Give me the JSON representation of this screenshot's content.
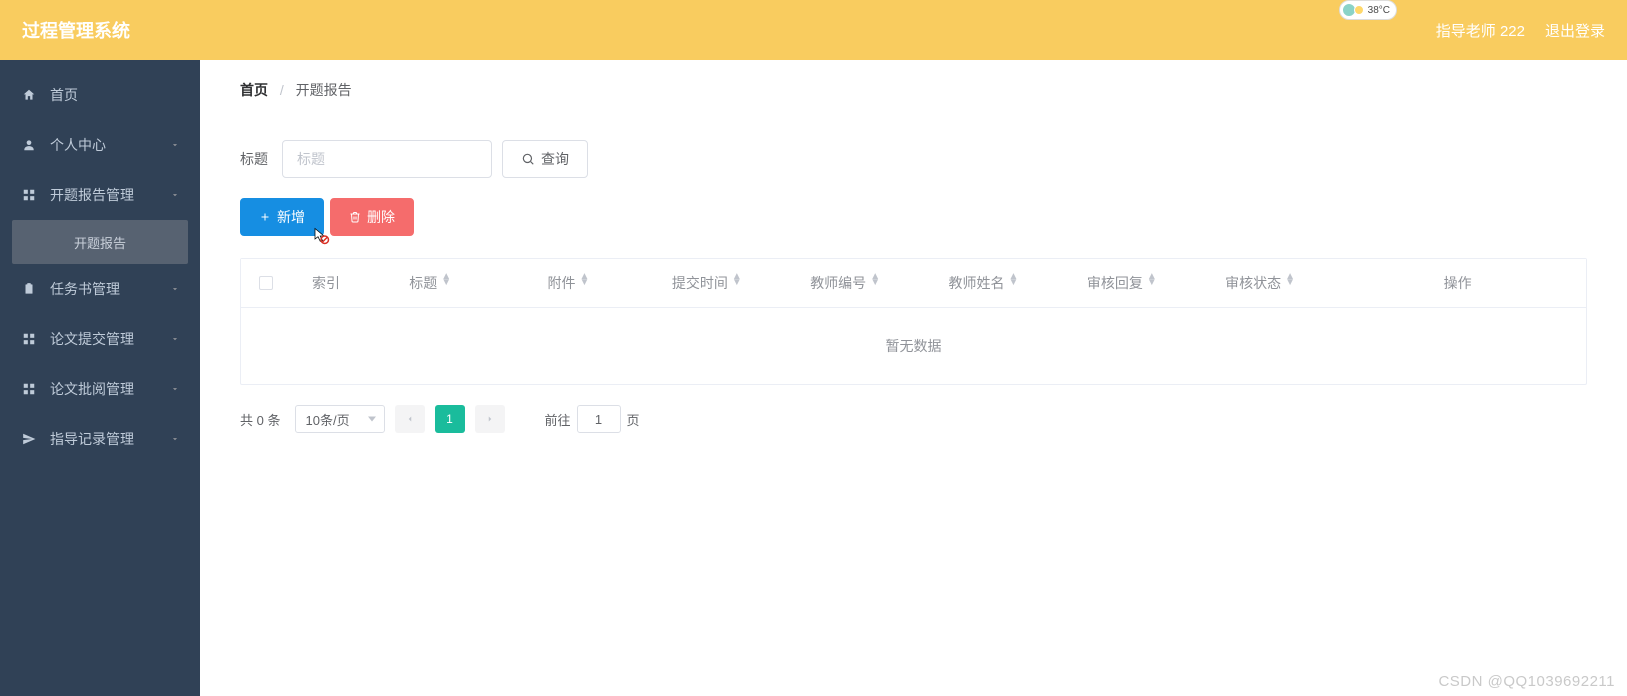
{
  "header": {
    "title": "过程管理系统",
    "user_label": "指导老师 222",
    "logout": "退出登录",
    "weather_temp": "38°C"
  },
  "sidebar": {
    "items": [
      {
        "icon": "home",
        "label": "首页",
        "has_arrow": false
      },
      {
        "icon": "person",
        "label": "个人中心",
        "has_arrow": true
      },
      {
        "icon": "grid",
        "label": "开题报告管理",
        "has_arrow": true,
        "open": true,
        "children": [
          {
            "label": "开题报告"
          }
        ]
      },
      {
        "icon": "clipboard",
        "label": "任务书管理",
        "has_arrow": true
      },
      {
        "icon": "grid",
        "label": "论文提交管理",
        "has_arrow": true
      },
      {
        "icon": "grid",
        "label": "论文批阅管理",
        "has_arrow": true
      },
      {
        "icon": "send",
        "label": "指导记录管理",
        "has_arrow": true
      }
    ]
  },
  "breadcrumb": {
    "home": "首页",
    "current": "开题报告"
  },
  "search": {
    "label": "标题",
    "placeholder": "标题",
    "query_btn": "查询"
  },
  "actions": {
    "add": "新增",
    "delete": "删除"
  },
  "table": {
    "columns": [
      "索引",
      "标题",
      "附件",
      "提交时间",
      "教师编号",
      "教师姓名",
      "审核回复",
      "审核状态",
      "操作"
    ],
    "empty_text": "暂无数据"
  },
  "pagination": {
    "total_prefix": "共",
    "total_count": "0",
    "total_suffix": "条",
    "page_size_label": "10条/页",
    "current_page": "1",
    "jump_prefix": "前往",
    "jump_value": "1",
    "jump_suffix": "页"
  },
  "watermark": "CSDN @QQ1039692211"
}
